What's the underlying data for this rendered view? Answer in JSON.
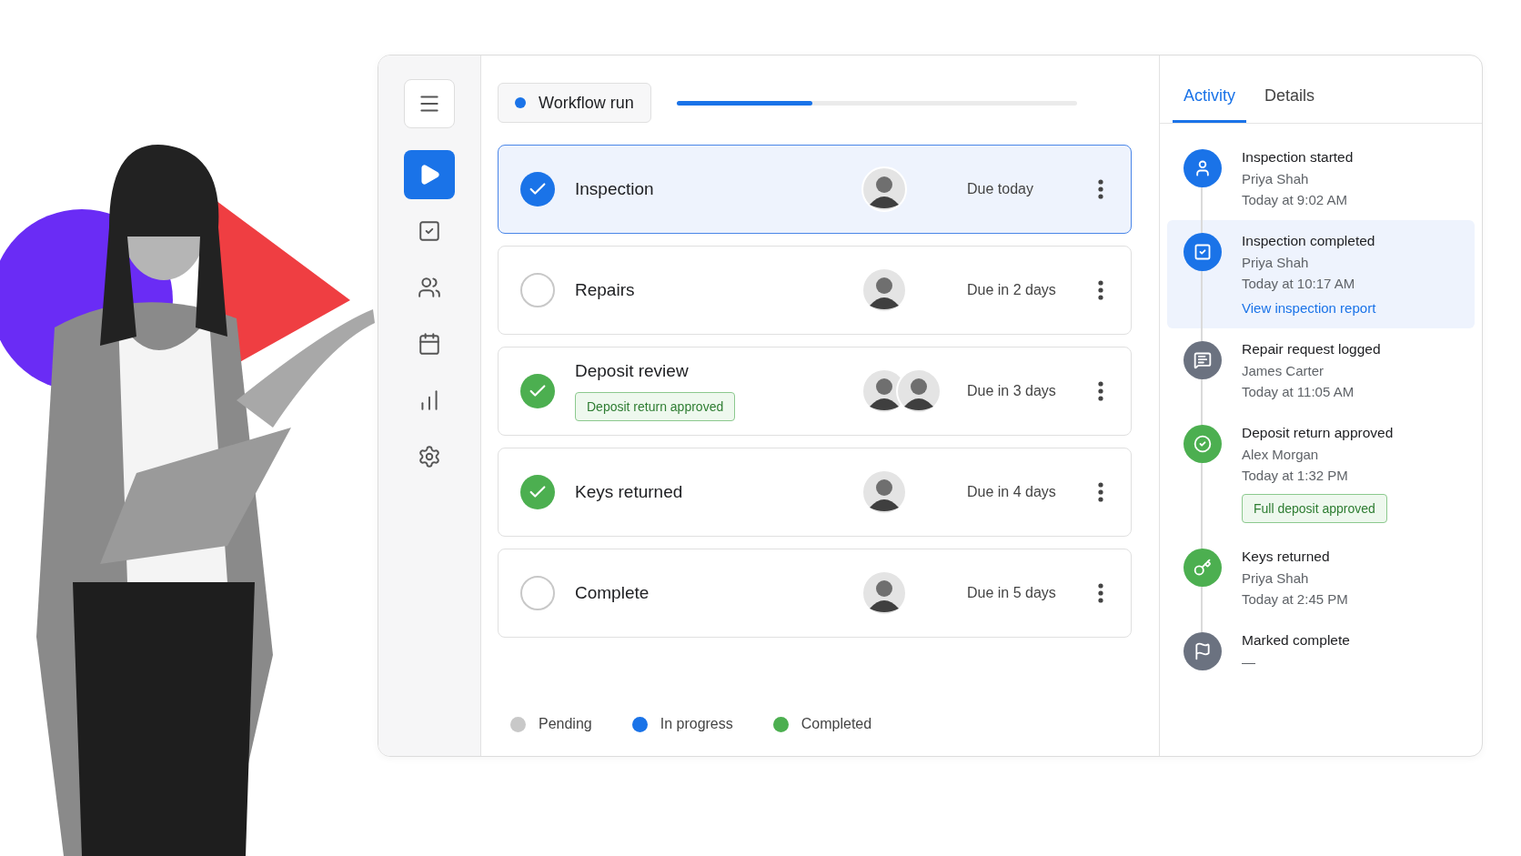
{
  "sidebar": {
    "items": [
      {
        "kind": "menu",
        "selected": false
      },
      {
        "kind": "play",
        "selected": true
      },
      {
        "kind": "tasks",
        "selected": false
      },
      {
        "kind": "people",
        "selected": false
      },
      {
        "kind": "calendar",
        "selected": false
      },
      {
        "kind": "chart",
        "selected": false
      },
      {
        "kind": "settings",
        "selected": false
      }
    ]
  },
  "header": {
    "title": "Workflow run",
    "progress": {
      "level": 0.34
    }
  },
  "tasks": [
    {
      "title": "Inspection",
      "kind": "active",
      "selected": true,
      "assignees": [
        {
          "kind": "person"
        }
      ],
      "due": "Due today"
    },
    {
      "title": "Repairs",
      "kind": "pending",
      "selected": false,
      "assignees": [
        {
          "kind": "person"
        }
      ],
      "due": "Due in 2 days"
    },
    {
      "title": "Deposit review",
      "kind": "done",
      "selected": false,
      "assignees": [
        {
          "kind": "person"
        },
        {
          "kind": "person"
        }
      ],
      "due": "Due in 3 days",
      "tag": "Deposit return approved"
    },
    {
      "title": "Keys returned",
      "kind": "done",
      "selected": false,
      "assignees": [
        {
          "kind": "person"
        }
      ],
      "due": "Due in 4 days"
    },
    {
      "title": "Complete",
      "kind": "pending",
      "selected": false,
      "assignees": [
        {
          "kind": "person"
        }
      ],
      "due": "Due in 5 days"
    }
  ],
  "legend": [
    {
      "label": "Pending",
      "color": "#c8c8c8"
    },
    {
      "label": "In progress",
      "color": "#1a73e8"
    },
    {
      "label": "Completed",
      "color": "#4caf50"
    }
  ],
  "tabs": [
    {
      "label": "Activity",
      "selected": true
    },
    {
      "label": "Details",
      "selected": false
    }
  ],
  "activity": [
    {
      "kind": "person",
      "color": "#1a73e8",
      "title": "Inspection started",
      "name": "Priya Shah",
      "time": "Today at 9:02 AM",
      "selected": false
    },
    {
      "kind": "check",
      "color": "#1a73e8",
      "title": "Inspection completed",
      "name": "Priya Shah",
      "time": "Today at 10:17 AM",
      "link": "View inspection report",
      "selected": true
    },
    {
      "kind": "comment",
      "color": "#6b7280",
      "title": "Repair request logged",
      "name": "James Carter",
      "time": "Today at 11:05 AM",
      "selected": false
    },
    {
      "kind": "approved",
      "color": "#4caf50",
      "title": "Deposit return approved",
      "name": "Alex Morgan",
      "time": "Today at 1:32 PM",
      "tag": "Full deposit approved",
      "selected": false
    },
    {
      "kind": "key",
      "color": "#4caf50",
      "title": "Keys returned",
      "name": "Priya Shah",
      "time": "Today at 2:45 PM",
      "selected": false
    },
    {
      "kind": "flag",
      "color": "#6b7280",
      "title": "Marked complete",
      "name": "—",
      "selected": false
    }
  ]
}
